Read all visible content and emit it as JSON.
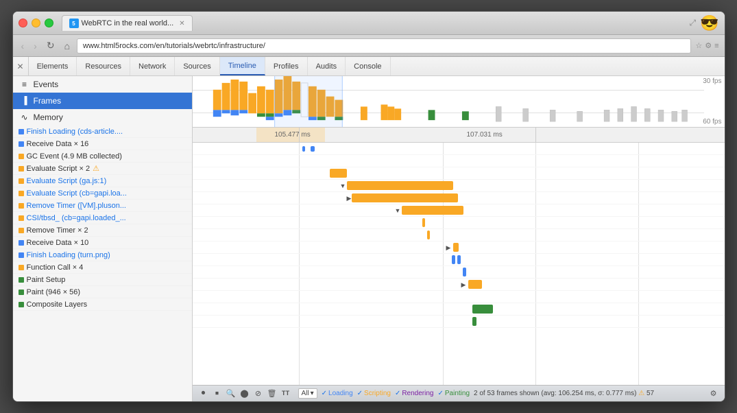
{
  "browser": {
    "tab_title": "WebRTC in the real world...",
    "tab_favicon": "5",
    "url": "www.html5rocks.com/en/tutorials/webrtc/infrastructure/",
    "emoji": "😎"
  },
  "devtools": {
    "tabs": [
      {
        "label": "Elements",
        "active": false
      },
      {
        "label": "Resources",
        "active": false
      },
      {
        "label": "Network",
        "active": false
      },
      {
        "label": "Sources",
        "active": false
      },
      {
        "label": "Timeline",
        "active": true
      },
      {
        "label": "Profiles",
        "active": false
      },
      {
        "label": "Audits",
        "active": false
      },
      {
        "label": "Console",
        "active": false
      }
    ],
    "sidebar": {
      "items": [
        {
          "label": "Events",
          "icon": "events",
          "active": false
        },
        {
          "label": "Frames",
          "icon": "frames",
          "active": true
        },
        {
          "label": "Memory",
          "icon": "memory",
          "active": false
        }
      ]
    },
    "fps": {
      "label_30": "30 fps",
      "label_60": "60 fps"
    },
    "ruler": {
      "marker1": "105.477 ms",
      "marker2": "107.031 ms"
    },
    "events": [
      {
        "color": "#4285f4",
        "text": "Finish Loading (cds-article....",
        "link": true
      },
      {
        "color": "#4285f4",
        "text": "Receive Data × 16",
        "link": false
      },
      {
        "color": "#f9a825",
        "text": "GC Event (4.9 MB collected)",
        "link": false
      },
      {
        "color": "#f9a825",
        "text": "Evaluate Script × 2",
        "link": false,
        "warning": true
      },
      {
        "color": "#f9a825",
        "text": "Evaluate Script (ga.js:1)",
        "link": true
      },
      {
        "color": "#f9a825",
        "text": "Evaluate Script (cb=gapi.loa...",
        "link": true
      },
      {
        "color": "#f9a825",
        "text": "Remove Timer (tVM].pluson...",
        "link": true
      },
      {
        "color": "#f9a825",
        "text": "CSI/tbsd_ (cb=gapi.loaded_...",
        "link": true
      },
      {
        "color": "#f9a825",
        "text": "Remove Timer × 2",
        "link": false
      },
      {
        "color": "#4285f4",
        "text": "Receive Data × 10",
        "link": false
      },
      {
        "color": "#4285f4",
        "text": "Finish Loading (turn.png)",
        "link": true
      },
      {
        "color": "#f9a825",
        "text": "Function Call × 4",
        "link": false
      },
      {
        "color": "#388e3c",
        "text": "Paint Setup",
        "link": false
      },
      {
        "color": "#388e3c",
        "text": "Paint (946 × 56)",
        "link": false
      },
      {
        "color": "#388e3c",
        "text": "Composite Layers",
        "link": false
      }
    ],
    "status": {
      "filter_all": "All",
      "loading_label": "Loading",
      "scripting_label": "Scripting",
      "rendering_label": "Rendering",
      "painting_label": "Painting",
      "frames_text": "2 of 53 frames shown",
      "avg_text": "(avg: 106.254 ms, σ: 0.777 ms)",
      "frame_count": "57"
    }
  }
}
